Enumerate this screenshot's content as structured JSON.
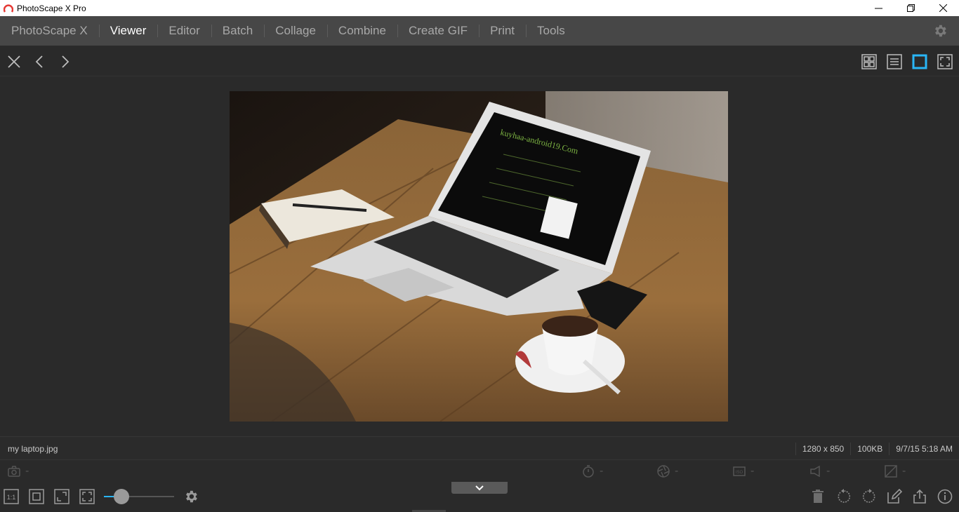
{
  "window": {
    "title": "PhotoScape X Pro",
    "controls": [
      "minimize-icon",
      "restore-icon",
      "close-icon"
    ]
  },
  "menu": {
    "items": [
      {
        "label": "PhotoScape X",
        "active": false
      },
      {
        "label": "Viewer",
        "active": true
      },
      {
        "label": "Editor",
        "active": false
      },
      {
        "label": "Batch",
        "active": false
      },
      {
        "label": "Collage",
        "active": false
      },
      {
        "label": "Combine",
        "active": false
      },
      {
        "label": "Create GIF",
        "active": false
      },
      {
        "label": "Print",
        "active": false
      },
      {
        "label": "Tools",
        "active": false
      }
    ],
    "settings_icon": "gear-icon"
  },
  "toolbar": {
    "left": [
      "close-icon",
      "chevron-left-icon",
      "chevron-right-icon"
    ],
    "right": [
      "grid-view-icon",
      "list-view-icon",
      "single-view-icon",
      "fullscreen-icon"
    ],
    "selected_view": "single-view-icon",
    "accent": "#29b6f6"
  },
  "image": {
    "description_icon": "photo-laptop-on-table"
  },
  "status": {
    "filename": "my laptop.jpg",
    "dimensions": "1280 x 850",
    "filesize": "100KB",
    "datetime": "9/7/15 5:18 AM"
  },
  "exif": {
    "camera_icon": "camera-icon",
    "camera_value": "-",
    "shutter_icon": "stopwatch-icon",
    "shutter_value": "-",
    "aperture_icon": "aperture-icon",
    "aperture_value": "-",
    "iso_icon": "iso-icon",
    "iso_value": "-",
    "flash_icon": "flash-icon",
    "flash_value": "-",
    "exposure_icon": "exposure-icon",
    "exposure_value": "-"
  },
  "bottom": {
    "left": [
      "actual-size-icon",
      "fit-icon",
      "fit-width-icon",
      "fullscreen-fit-icon"
    ],
    "zoom_level": 0.25,
    "right": [
      "trash-icon",
      "rotate-left-icon",
      "rotate-right-icon",
      "edit-icon",
      "share-icon",
      "info-icon"
    ],
    "settings_icon": "gear-icon"
  }
}
